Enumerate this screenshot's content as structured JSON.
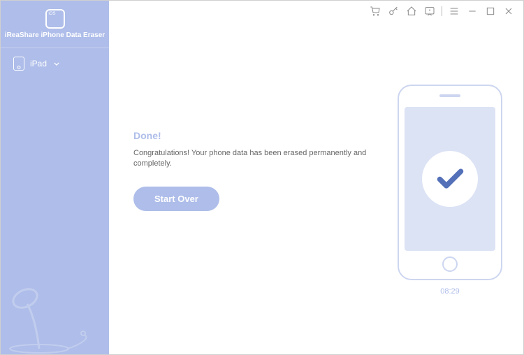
{
  "app": {
    "title": "iReaShare iPhone Data Eraser"
  },
  "sidebar": {
    "device_label": "iPad"
  },
  "main": {
    "done_title": "Done!",
    "done_message": "Congratulations! Your phone data has been erased permanently and completely.",
    "start_over_label": "Start Over"
  },
  "phone": {
    "time": "08:29"
  }
}
